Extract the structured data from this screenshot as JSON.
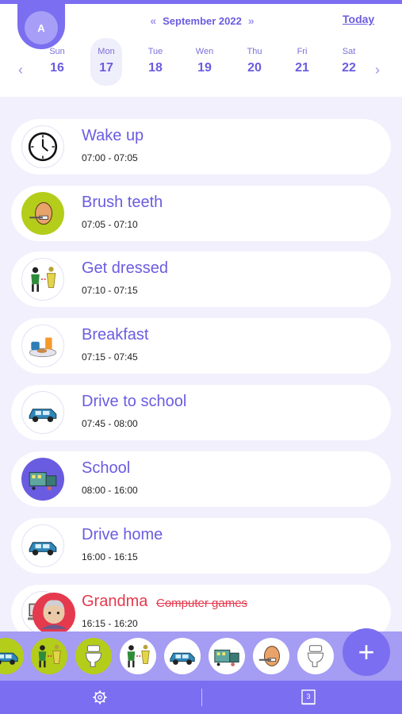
{
  "header": {
    "avatar_letter": "A",
    "month_label": "September 2022",
    "prev_month_glyph": "«",
    "next_month_glyph": "»",
    "today_label": "Today"
  },
  "week": {
    "prev_glyph": "‹",
    "next_glyph": "›",
    "days": [
      {
        "name": "Sun",
        "num": "16"
      },
      {
        "name": "Mon",
        "num": "17"
      },
      {
        "name": "Tue",
        "num": "18"
      },
      {
        "name": "Wen",
        "num": "19"
      },
      {
        "name": "Thu",
        "num": "20"
      },
      {
        "name": "Fri",
        "num": "21"
      },
      {
        "name": "Sat",
        "num": "22"
      }
    ],
    "selected_index": 1
  },
  "activities": [
    {
      "title": "Wake up",
      "time": "07:00 - 07:05",
      "icon": "clock-icon"
    },
    {
      "title": "Brush teeth",
      "time": "07:05 - 07:10",
      "icon": "brush-teeth-icon"
    },
    {
      "title": "Get dressed",
      "time": "07:10 - 07:15",
      "icon": "get-dressed-icon"
    },
    {
      "title": "Breakfast",
      "time": "07:15 - 07:45",
      "icon": "breakfast-icon"
    },
    {
      "title": "Drive to school",
      "time": "07:45 - 08:00",
      "icon": "car-icon"
    },
    {
      "title": "School",
      "time": "08:00 - 16:00",
      "icon": "school-icon"
    },
    {
      "title": "Drive home",
      "time": "16:00 - 16:15",
      "icon": "car-icon"
    },
    {
      "title": "Grandma",
      "time": "16:15 - 16:20",
      "icon": "grandma-icon",
      "replaced": "Computer games"
    }
  ],
  "tray": {
    "icons": [
      "car-icon",
      "get-dressed-icon",
      "toilet-icon",
      "get-dressed-icon",
      "car-icon",
      "school-icon",
      "brush-teeth-icon",
      "toilet-icon"
    ],
    "add_glyph": "+"
  },
  "bottom_nav": {
    "settings_icon": "gear-icon",
    "calendar_icon": "calendar-icon",
    "calendar_number": "3"
  },
  "colors": {
    "accent": "#7b6ef0",
    "text": "#6a5ce0",
    "lime": "#b4cd1a",
    "alert": "#e5394d",
    "background": "#f1f0fc"
  }
}
